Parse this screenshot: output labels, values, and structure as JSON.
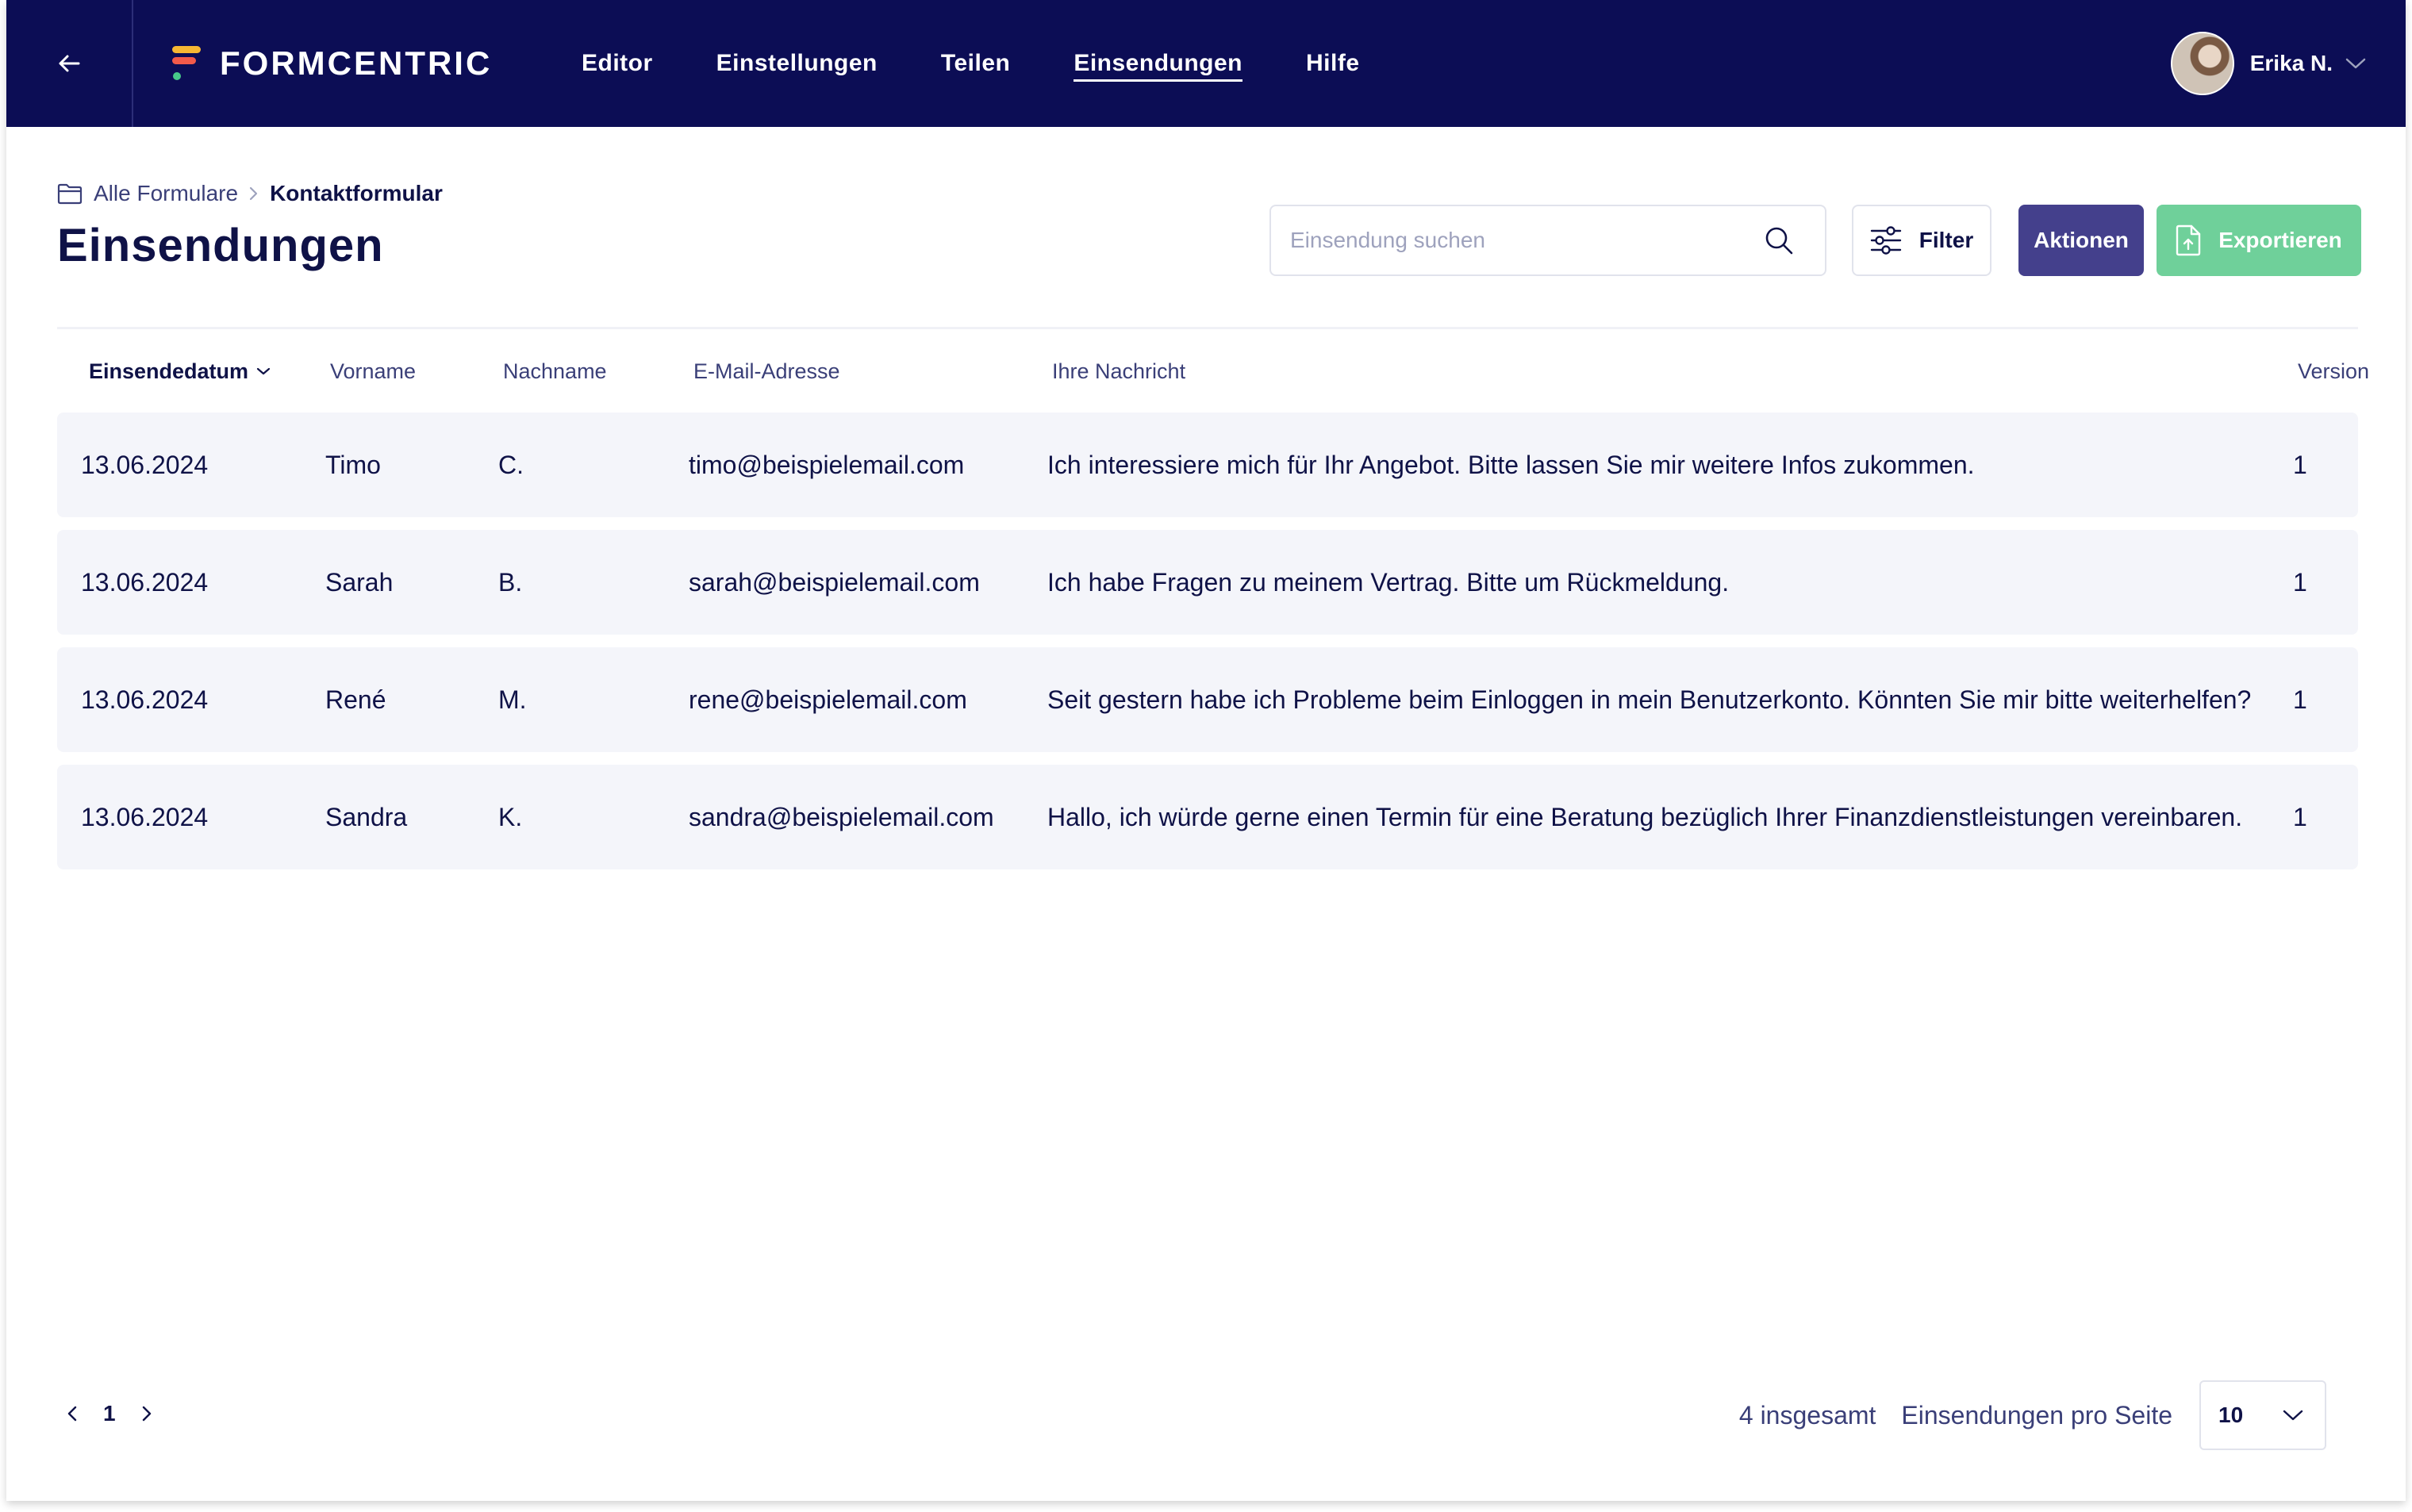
{
  "app": {
    "brand": "FORMCENTRIC"
  },
  "nav": [
    {
      "label": "Editor",
      "active": false
    },
    {
      "label": "Einstellungen",
      "active": false
    },
    {
      "label": "Teilen",
      "active": false
    },
    {
      "label": "Einsendungen",
      "active": true
    },
    {
      "label": "Hilfe",
      "active": false
    }
  ],
  "user": {
    "name": "Erika N."
  },
  "breadcrumb": {
    "root": "Alle Formulare",
    "current": "Kontaktformular"
  },
  "page": {
    "title": "Einsendungen"
  },
  "search": {
    "placeholder": "Einsendung suchen",
    "value": ""
  },
  "toolbar": {
    "filter_label": "Filter",
    "actions_label": "Aktionen",
    "export_label": "Exportieren"
  },
  "table": {
    "columns": [
      "Einsendedatum",
      "Vorname",
      "Nachname",
      "E-Mail-Adresse",
      "Ihre Nachricht",
      "Version"
    ],
    "sort_column": "Einsendedatum",
    "rows": [
      [
        "13.06.2024",
        "Timo",
        "C.",
        "timo@beispielemail.com",
        "Ich interessiere mich für Ihr Angebot. Bitte lassen Sie mir weitere Infos zukommen.",
        "1"
      ],
      [
        "13.06.2024",
        "Sarah",
        "B.",
        "sarah@beispielemail.com",
        "Ich habe Fragen zu meinem Vertrag. Bitte um Rückmeldung.",
        "1"
      ],
      [
        "13.06.2024",
        "René",
        "M.",
        "rene@beispielemail.com",
        "Seit gestern habe ich Probleme beim Einloggen in mein Benutzerkonto. Könnten Sie mir bitte weiterhelfen?",
        "1"
      ],
      [
        "13.06.2024",
        "Sandra",
        "K.",
        "sandra@beispielemail.com",
        "Hallo, ich würde gerne einen Termin für eine Beratung bezüglich Ihrer Finanzdienstleistungen vereinbaren.",
        "1"
      ]
    ]
  },
  "pagination": {
    "current_page": "1",
    "total": "4 insgesamt",
    "per_page_label": "Einsendungen pro Seite",
    "per_page": "10"
  },
  "colors": {
    "navbar": "#0c0d55",
    "primary_text": "#0f1247",
    "actions_button": "#44408c",
    "export_button": "#6fd09a",
    "row_background": "#f4f5fa"
  },
  "icons": [
    "arrow-left-icon",
    "logo-mark",
    "chevron-down-icon",
    "folder-icon",
    "chevron-right-icon",
    "search-icon",
    "sliders-icon",
    "file-upload-icon",
    "chevron-left-icon"
  ]
}
